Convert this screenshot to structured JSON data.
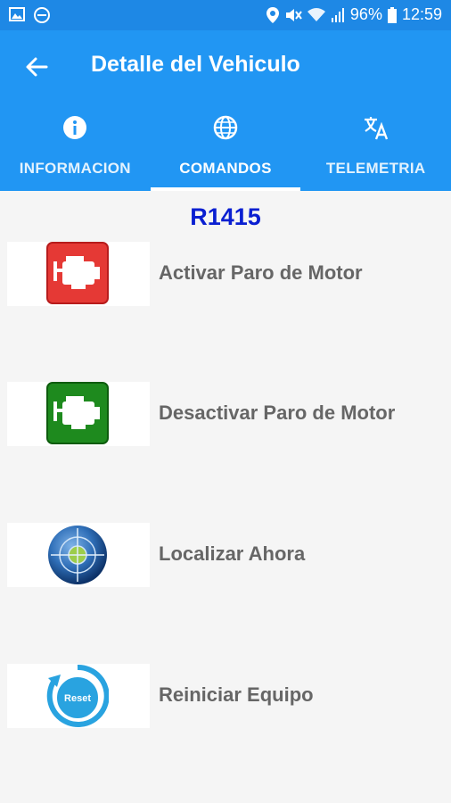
{
  "status_bar": {
    "battery": "96%",
    "time": "12:59",
    "icons": [
      "image-icon",
      "do-not-disturb-icon",
      "location-icon",
      "mute-icon",
      "wifi-icon",
      "signal-icon",
      "battery-icon"
    ]
  },
  "app_bar": {
    "title": "Detalle del Vehiculo",
    "back_icon": "arrow-back-icon"
  },
  "tabs": [
    {
      "label": "INFORMACION",
      "icon": "info-icon",
      "active": false
    },
    {
      "label": "COMANDOS",
      "icon": "globe-icon",
      "active": true
    },
    {
      "label": "TELEMETRIA",
      "icon": "translate-icon",
      "active": false
    }
  ],
  "vehicle": {
    "id": "R1415"
  },
  "commands": [
    {
      "label": "Activar Paro de Motor",
      "icon": "engine-red-icon",
      "color": "#e53935"
    },
    {
      "label": "Desactivar Paro de Motor",
      "icon": "engine-green-icon",
      "color": "#1e8a1e"
    },
    {
      "label": "Localizar Ahora",
      "icon": "locate-target-icon"
    },
    {
      "label": "Reiniciar Equipo",
      "icon": "reset-icon",
      "icon_text": "Reset"
    }
  ],
  "colors": {
    "app_bar": "#2196f3",
    "status_bar": "#1e88e5",
    "vehicle_id": "#0a1fd1",
    "command_text": "#666666"
  }
}
